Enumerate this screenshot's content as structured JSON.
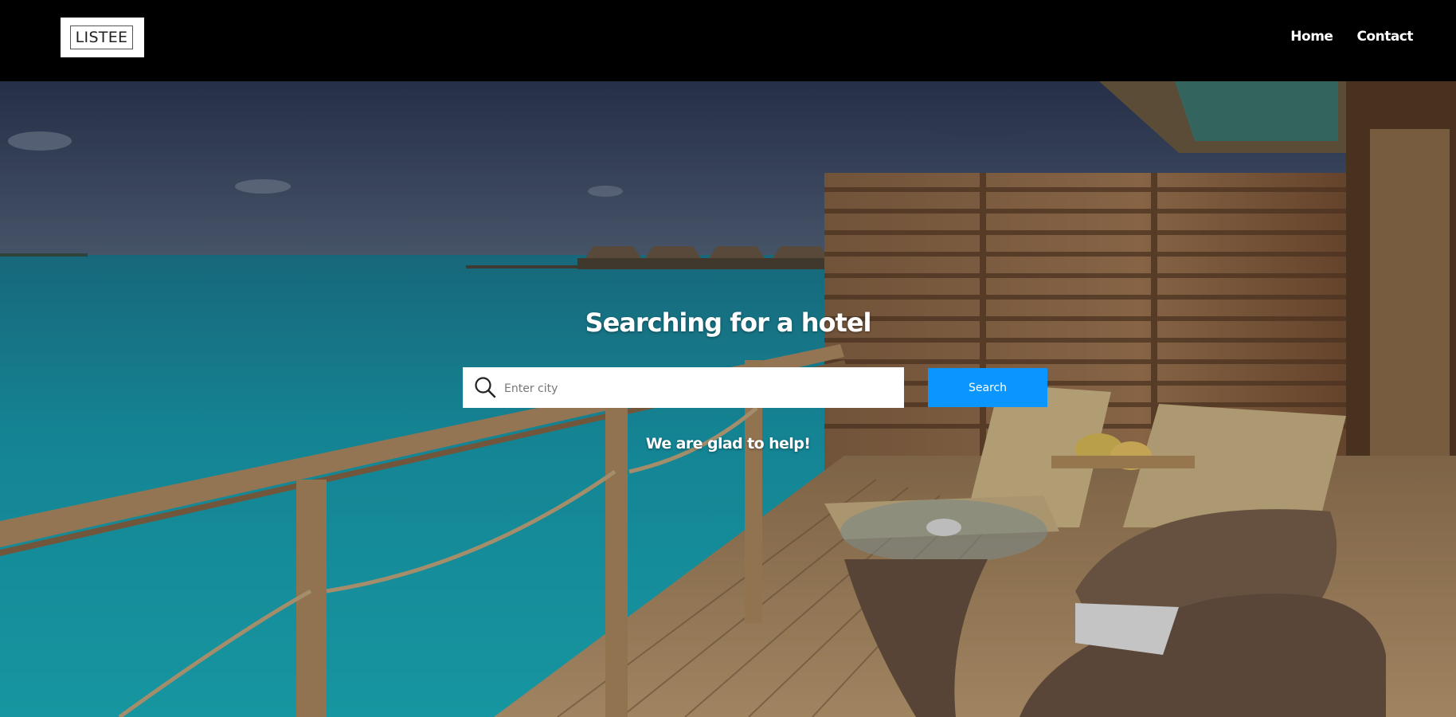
{
  "header": {
    "logo_text": "LISTEE",
    "nav": [
      {
        "label": "Home"
      },
      {
        "label": "Contact"
      }
    ]
  },
  "hero": {
    "title": "Searching for a hotel",
    "search": {
      "placeholder": "Enter city",
      "value": "",
      "button_label": "Search"
    },
    "tagline": "We are glad to help!"
  },
  "colors": {
    "header_bg": "#000000",
    "accent": "#0a95ff",
    "text_light": "#ffffff"
  },
  "icons": [
    "search-icon"
  ]
}
